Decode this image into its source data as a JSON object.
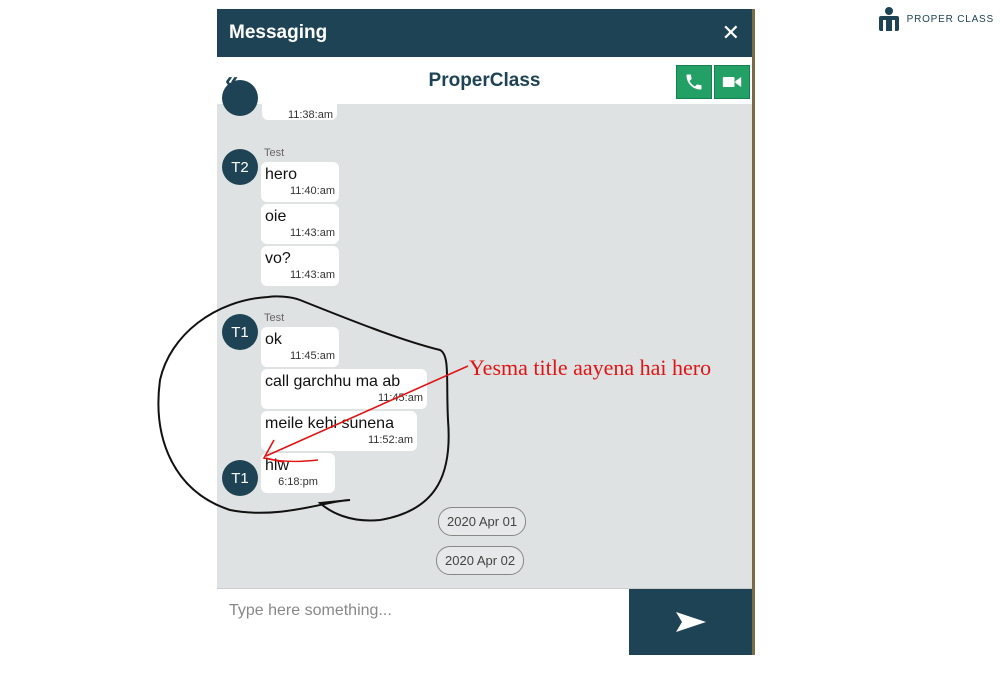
{
  "brand": {
    "name": "PROPER CLASS"
  },
  "window": {
    "title": "Messaging",
    "close_glyph": "✕"
  },
  "chat": {
    "back_glyph": "«",
    "contact": "ProperClass"
  },
  "messages": [
    {
      "time": "11:38:am"
    },
    {
      "avatar": "T2",
      "sender": "Test",
      "text": "hero",
      "time": "11:40:am"
    },
    {
      "text": "oie",
      "time": "11:43:am"
    },
    {
      "text": "vo?",
      "time": "11:43:am"
    },
    {
      "avatar": "T1",
      "sender": "Test",
      "text": "ok",
      "time": "11:45:am"
    },
    {
      "text": "call garchhu ma ab",
      "time": "11:45:am"
    },
    {
      "text": "meile kehi sunena",
      "time": "11:52:am"
    },
    {
      "avatar": "T1",
      "text": "hlw",
      "time": "6:18:pm"
    }
  ],
  "dates": [
    "2020 Apr 01",
    "2020 Apr 02"
  ],
  "composer": {
    "placeholder": "Type here something..."
  },
  "annotation": {
    "text": "Yesma title aayena hai hero"
  },
  "colors": {
    "primary": "#1e4354",
    "call_green": "#22a065",
    "annotation_red": "#e01414"
  },
  "icons": [
    "phone-icon",
    "video-camera-icon",
    "send-icon",
    "close-icon",
    "back-chevron-icon",
    "brand-logo-icon"
  ]
}
